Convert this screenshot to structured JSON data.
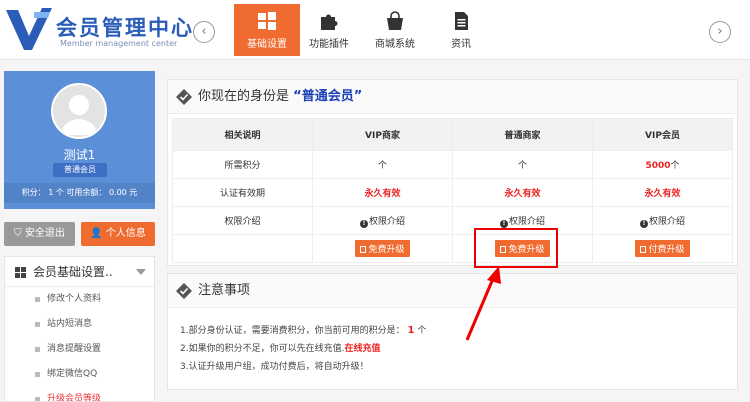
{
  "header": {
    "logo_title": "会员管理中心",
    "logo_subtitle": "Member management center",
    "nav": [
      {
        "label": "基础设置",
        "icon": "windows-icon",
        "active": true
      },
      {
        "label": "功能插件",
        "icon": "puzzle-icon",
        "active": false
      },
      {
        "label": "商城系统",
        "icon": "shopping-bag-icon",
        "active": false
      },
      {
        "label": "资讯",
        "icon": "document-icon",
        "active": false
      }
    ],
    "prev_arrow": "‹",
    "next_arrow": "›"
  },
  "profile": {
    "username": "测试1",
    "level": "普通会员",
    "stats": "积分： 1 个  可用余额： 0.00 元"
  },
  "actions": {
    "logout": "安全退出",
    "profile_info": "个人信息"
  },
  "menu": {
    "title": "会员基础设置..",
    "items": [
      "修改个人资料",
      "站内短消息",
      "消息提醒设置",
      "绑定微信QQ",
      "升级会员等级"
    ]
  },
  "identity_panel": {
    "prefix": "你现在的身份是",
    "open_quote": "“",
    "identity": "普通会员",
    "close_quote": "”"
  },
  "table": {
    "headers": [
      "相关说明",
      "VIP商家",
      "普通商家",
      "VIP会员"
    ],
    "rows": {
      "points_label": "所需积分",
      "points": [
        "个",
        "个",
        "5000",
        "个"
      ],
      "validity_label": "认证有效期",
      "validity": [
        "永久有效",
        "永久有效",
        "永久有效"
      ],
      "perm_label": "权限介绍",
      "perm": [
        "权限介绍",
        "权限介绍",
        "权限介绍"
      ],
      "upgrade": [
        "免费升级",
        "免费升级",
        "付费升级"
      ]
    }
  },
  "notes_panel": {
    "title": "注意事项",
    "line1_text": "1.部分身份认证，需要消费积分，你当前可用的积分是：",
    "line1_value": "1",
    "line1_unit": "个",
    "line2_text": "2.如果你的积分不足，你可以先在线充值.",
    "line2_link": "在线充值",
    "line3_text": "3.认证升级用户组，成功付费后，将自动升级！"
  },
  "colors": {
    "accent": "#f06b2f",
    "profile_bg": "#5b8fd8",
    "highlight_red": "#e22222",
    "identity_blue": "#1a3fb5"
  }
}
